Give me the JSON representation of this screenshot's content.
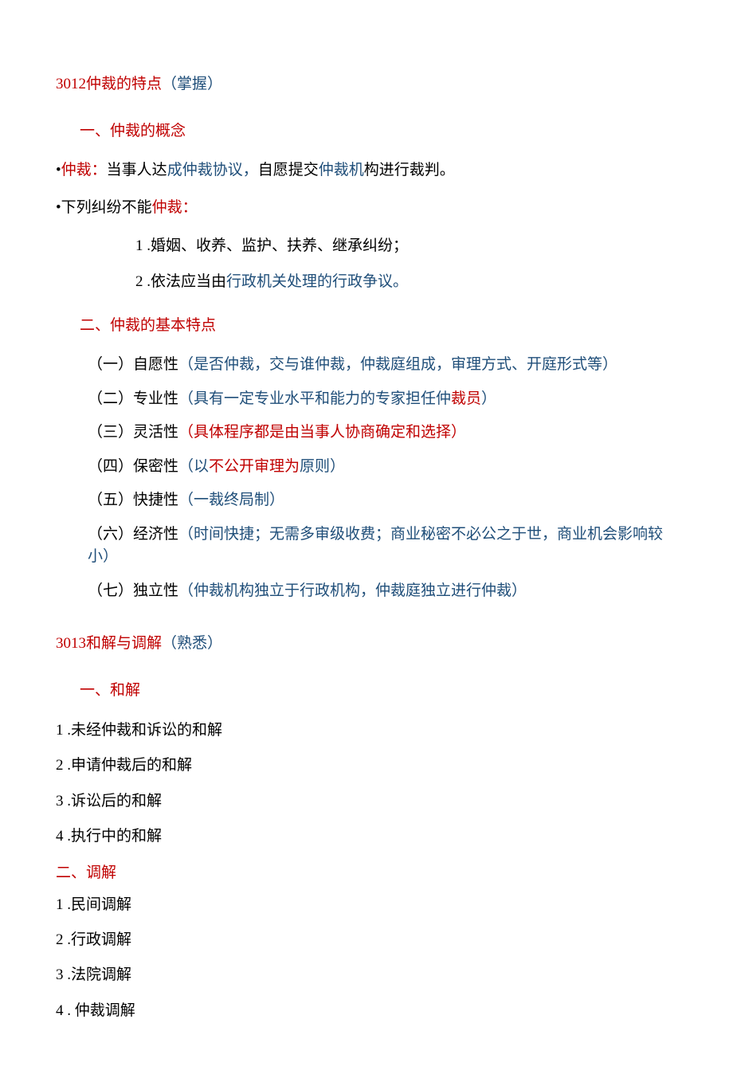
{
  "s3012": {
    "title_num": "3012",
    "title_text": "仲裁的特点",
    "title_note": "（掌握）",
    "h1": "一、仲裁的概念",
    "b1_bullet": "•",
    "b1_red": "仲裁：",
    "b1_black1": "当事人达",
    "b1_blue1": "成仲裁协议，",
    "b1_black2": "自愿提交",
    "b1_blue2": "仲裁机",
    "b1_black3": "构进行裁判。",
    "b2_bullet": "•",
    "b2_black": "下列纠纷不能",
    "b2_red": "仲裁：",
    "n1": "1 .婚姻、收养、监护、扶养、继承纠纷；",
    "n2_pre": "2 .依法应当由",
    "n2_blue": "行政机关处理的行政争议。",
    "h2": "二、仲裁的基本特点",
    "f1_black": "（一）自愿性",
    "f1_blue": "（是否仲裁，交与谁仲裁，仲裁庭组成，审理方式、开庭形式等）",
    "f2_black": "（二）专业性",
    "f2_blue": "（具有一定专业水平和能力的专家担任仲",
    "f2_red": "裁员",
    "f2_blue2": "）",
    "f3_black": "（三）灵活性",
    "f3_red": "（具体程序都是由当事人协商确定和选择）",
    "f4_black": "（四）保密性",
    "f4_blue1": "（以",
    "f4_red": "不公开审理为",
    "f4_blue2": "原则）",
    "f5_black": "（五）快捷性",
    "f5_blue": "（一裁终局制）",
    "f6_black": "（六）经济性",
    "f6_blue": "（时间快捷；无需多审级收费；商业秘密不必公之于世，商业机会影响较小）",
    "f7_black": "（七）独立性",
    "f7_blue": "（仲裁机构独立于行政机构，仲裁庭独立进行仲裁）"
  },
  "s3013": {
    "title_num": "3013",
    "title_text": "和解与调解",
    "title_note": "（熟悉）",
    "h1": "一、和解",
    "l1": "1 .未经仲裁和诉讼的和解",
    "l2": "2 .申请仲裁后的和解",
    "l3": "3 .诉讼后的和解",
    "l4": "4 .执行中的和解",
    "h2": "二、调解",
    "m1": "1 .民间调解",
    "m2": "2 .行政调解",
    "m3": "3 .法院调解",
    "m4": "4 . 仲裁调解"
  }
}
